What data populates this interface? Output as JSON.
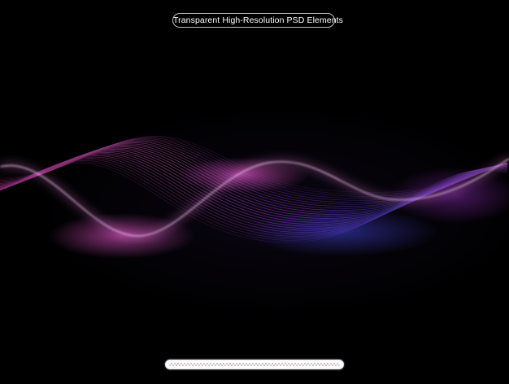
{
  "header": {
    "badge_label": "Transparent High-Resolution PSD Elements"
  },
  "artwork": {
    "icon": "neon-wave-icon",
    "colors": {
      "pink": "#ff4fd8",
      "magenta": "#c43cff",
      "violet": "#8a4dff",
      "blue": "#4a5bff"
    }
  },
  "footer": {
    "icon": "transparency-slider-icon"
  }
}
